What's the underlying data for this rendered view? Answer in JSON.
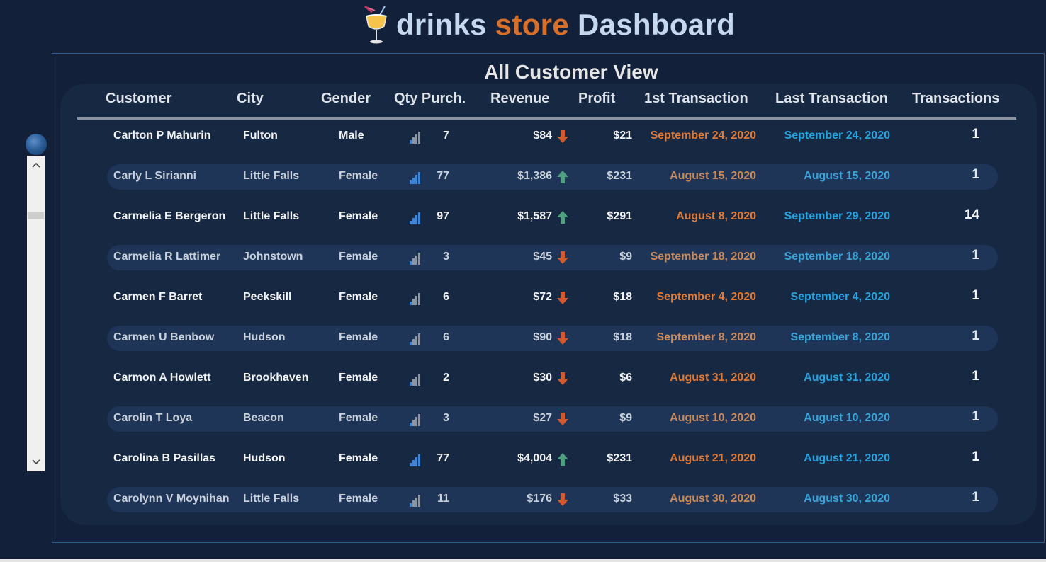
{
  "title": {
    "part1": "drinks",
    "part2": "store",
    "part3": "Dashboard"
  },
  "view_title": "All Customer View",
  "columns": [
    "Customer",
    "City",
    "Gender",
    "Qty Purch.",
    "Revenue",
    "Profit",
    "1st Transaction",
    "Last Transaction",
    "Transactions"
  ],
  "colors": {
    "background": "#13203a",
    "panel": "#172843",
    "accent_orange": "#d9702a",
    "accent_blue": "#27a3e0",
    "arrow_up": "#4fa07e",
    "arrow_down": "#d25a2e"
  },
  "rows": [
    {
      "customer": "Carlton P Mahurin",
      "city": "Fulton",
      "gender": "Male",
      "qty": "7",
      "qty_icon": "bar-chart-icon",
      "revenue": "$84",
      "trend": "down",
      "profit": "$21",
      "first": "September 24, 2020",
      "last": "September 24, 2020",
      "transactions": "1"
    },
    {
      "customer": "Carly L Sirianni",
      "city": "Little Falls",
      "gender": "Female",
      "qty": "77",
      "qty_icon": "bar-chart-icon",
      "revenue": "$1,386",
      "trend": "up",
      "profit": "$231",
      "first": "August 15, 2020",
      "last": "August 15, 2020",
      "transactions": "1"
    },
    {
      "customer": "Carmelia E Bergeron",
      "city": "Little Falls",
      "gender": "Female",
      "qty": "97",
      "qty_icon": "bar-chart-icon",
      "revenue": "$1,587",
      "trend": "up",
      "profit": "$291",
      "first": "August 8, 2020",
      "last": "September 29, 2020",
      "transactions": "14"
    },
    {
      "customer": "Carmelia R Lattimer",
      "city": "Johnstown",
      "gender": "Female",
      "qty": "3",
      "qty_icon": "bar-chart-icon",
      "revenue": "$45",
      "trend": "down",
      "profit": "$9",
      "first": "September 18, 2020",
      "last": "September 18, 2020",
      "transactions": "1"
    },
    {
      "customer": "Carmen F Barret",
      "city": "Peekskill",
      "gender": "Female",
      "qty": "6",
      "qty_icon": "bar-chart-icon",
      "revenue": "$72",
      "trend": "down",
      "profit": "$18",
      "first": "September 4, 2020",
      "last": "September 4, 2020",
      "transactions": "1"
    },
    {
      "customer": "Carmen U Benbow",
      "city": "Hudson",
      "gender": "Female",
      "qty": "6",
      "qty_icon": "bar-chart-icon",
      "revenue": "$90",
      "trend": "down",
      "profit": "$18",
      "first": "September 8, 2020",
      "last": "September 8, 2020",
      "transactions": "1"
    },
    {
      "customer": "Carmon A Howlett",
      "city": "Brookhaven",
      "gender": "Female",
      "qty": "2",
      "qty_icon": "bar-chart-icon",
      "revenue": "$30",
      "trend": "down",
      "profit": "$6",
      "first": "August 31, 2020",
      "last": "August 31, 2020",
      "transactions": "1"
    },
    {
      "customer": "Carolin T Loya",
      "city": "Beacon",
      "gender": "Female",
      "qty": "3",
      "qty_icon": "bar-chart-icon",
      "revenue": "$27",
      "trend": "down",
      "profit": "$9",
      "first": "August 10, 2020",
      "last": "August 10, 2020",
      "transactions": "1"
    },
    {
      "customer": "Carolina B Pasillas",
      "city": "Hudson",
      "gender": "Female",
      "qty": "77",
      "qty_icon": "bar-chart-icon",
      "revenue": "$4,004",
      "trend": "up",
      "profit": "$231",
      "first": "August 21, 2020",
      "last": "August 21, 2020",
      "transactions": "1"
    },
    {
      "customer": "Carolynn V Moynihan",
      "city": "Little Falls",
      "gender": "Female",
      "qty": "11",
      "qty_icon": "bar-chart-icon",
      "revenue": "$176",
      "trend": "down",
      "profit": "$33",
      "first": "August 30, 2020",
      "last": "August 30, 2020",
      "transactions": "1"
    }
  ],
  "scrollbar": {
    "up_glyph": "⌃",
    "down_glyph": "⌄"
  }
}
